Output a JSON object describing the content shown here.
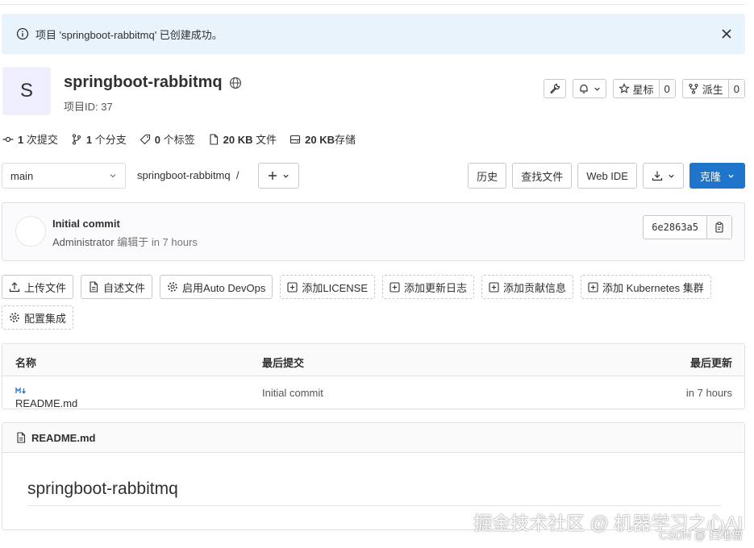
{
  "alert": {
    "message": "项目 'springboot-rabbitmq' 已创建成功。"
  },
  "project": {
    "avatar_letter": "S",
    "name": "springboot-rabbitmq",
    "id_label": "项目ID: 37"
  },
  "header_buttons": {
    "star_label": "星标",
    "star_count": "0",
    "fork_label": "派生",
    "fork_count": "0"
  },
  "stats": [
    {
      "num": "1",
      "label": "次提交"
    },
    {
      "num": "1",
      "label": "个分支"
    },
    {
      "num": "0",
      "label": "个标签"
    },
    {
      "num": "20 KB",
      "label": "文件"
    },
    {
      "num": "20 KB",
      "label": "存储"
    }
  ],
  "nav": {
    "branch": "main",
    "breadcrumb": "springboot-rabbitmq  /",
    "history": "历史",
    "find_file": "查找文件",
    "web_ide": "Web IDE",
    "clone": "克隆"
  },
  "commit": {
    "title": "Initial commit",
    "author": "Administrator",
    "meta": "编辑于 in 7 hours",
    "sha": "6e2863a5"
  },
  "actions": [
    {
      "label": "上传文件",
      "icon": "upload-icon",
      "dashed": false
    },
    {
      "label": "自述文件",
      "icon": "file-icon",
      "dashed": false
    },
    {
      "label": "启用Auto DevOps",
      "icon": "gear-icon",
      "dashed": false
    },
    {
      "label": "添加LICENSE",
      "icon": "plus-square-icon",
      "dashed": true
    },
    {
      "label": "添加更新日志",
      "icon": "plus-square-icon",
      "dashed": true
    },
    {
      "label": "添加贡献信息",
      "icon": "plus-square-icon",
      "dashed": true
    },
    {
      "label": "添加 Kubernetes 集群",
      "icon": "plus-square-icon",
      "dashed": true
    },
    {
      "label": "配置集成",
      "icon": "gear-icon",
      "dashed": true
    }
  ],
  "files": {
    "headers": {
      "name": "名称",
      "last_commit": "最后提交",
      "last_update": "最后更新"
    },
    "rows": [
      {
        "name": "README.md",
        "commit": "Initial commit",
        "updated": "in 7 hours"
      }
    ]
  },
  "readme": {
    "filename": "README.md",
    "heading": "springboot-rabbitmq"
  },
  "watermark": {
    "line1": "掘金技术社区 @ 机器学习之心AI",
    "line2": "CSDN @ 扫地僧"
  },
  "colors": {
    "primary": "#1f75cb",
    "alert_bg": "#e9f3fc",
    "avatar_bg": "#eeeeff"
  }
}
